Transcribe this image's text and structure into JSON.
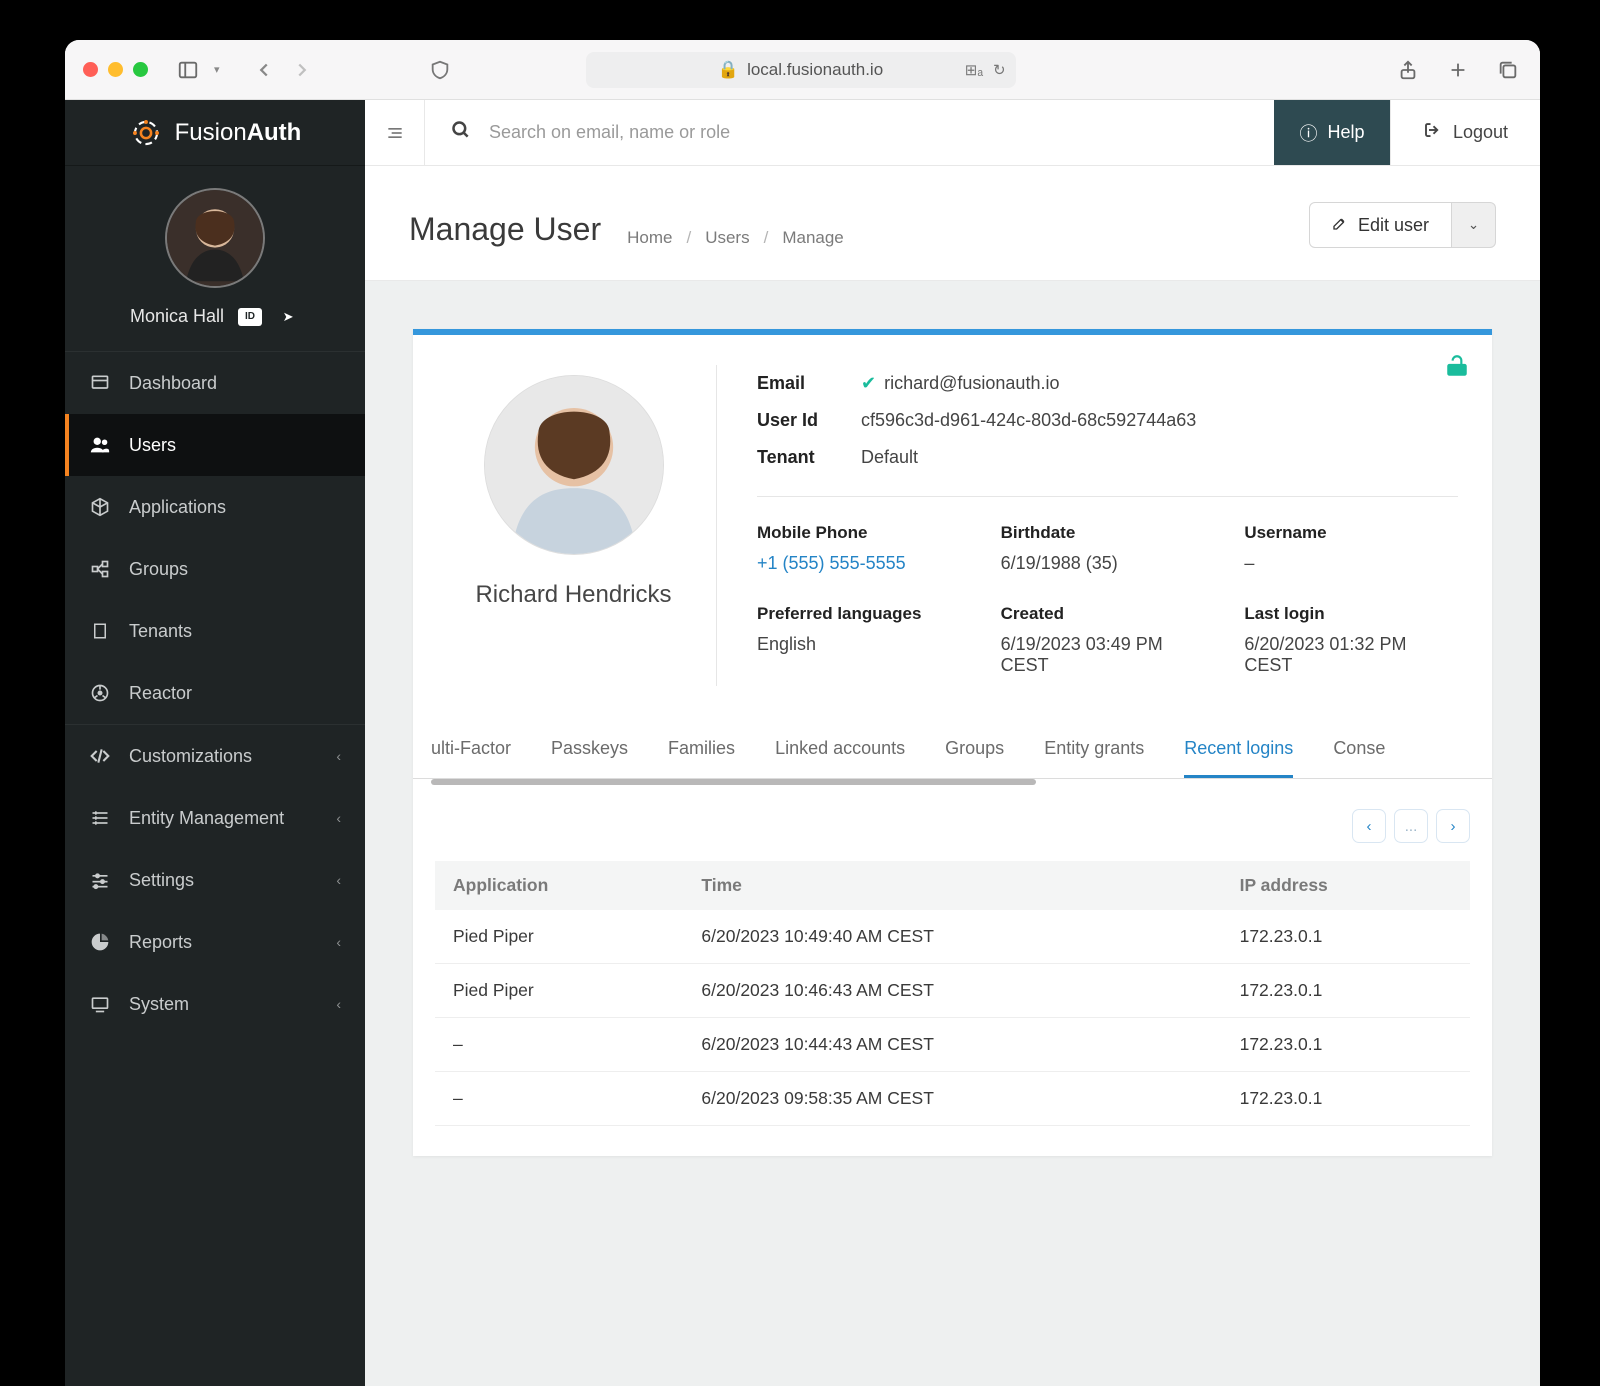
{
  "browser": {
    "address": "local.fusionauth.io"
  },
  "brand": {
    "first": "Fusion",
    "second": "Auth"
  },
  "currentUser": {
    "name": "Monica Hall"
  },
  "sidebar": {
    "items": [
      {
        "icon": "dashboard",
        "label": "Dashboard",
        "expandable": false
      },
      {
        "icon": "users",
        "label": "Users",
        "expandable": false,
        "active": true
      },
      {
        "icon": "applications",
        "label": "Applications",
        "expandable": false
      },
      {
        "icon": "groups",
        "label": "Groups",
        "expandable": false
      },
      {
        "icon": "tenants",
        "label": "Tenants",
        "expandable": false
      },
      {
        "icon": "reactor",
        "label": "Reactor",
        "expandable": false
      }
    ],
    "items2": [
      {
        "icon": "code",
        "label": "Customizations",
        "expandable": true
      },
      {
        "icon": "entity",
        "label": "Entity Management",
        "expandable": true
      },
      {
        "icon": "settings",
        "label": "Settings",
        "expandable": true
      },
      {
        "icon": "reports",
        "label": "Reports",
        "expandable": true
      },
      {
        "icon": "system",
        "label": "System",
        "expandable": true
      }
    ]
  },
  "topbar": {
    "search_placeholder": "Search on email, name or role",
    "help": "Help",
    "logout": "Logout"
  },
  "page": {
    "title": "Manage User",
    "breadcrumb": [
      "Home",
      "Users",
      "Manage"
    ],
    "edit_button": "Edit user"
  },
  "user": {
    "name": "Richard Hendricks",
    "labels": {
      "email": "Email",
      "user_id": "User Id",
      "tenant": "Tenant"
    },
    "email": "richard@fusionauth.io",
    "user_id": "cf596c3d-d961-424c-803d-68c592744a63",
    "tenant": "Default",
    "fields": {
      "mobile_phone": {
        "label": "Mobile Phone",
        "value": "+1 (555) 555-5555"
      },
      "birthdate": {
        "label": "Birthdate",
        "value": "6/19/1988 (35)"
      },
      "username": {
        "label": "Username",
        "value": "–"
      },
      "preferred_languages": {
        "label": "Preferred languages",
        "value": "English"
      },
      "created": {
        "label": "Created",
        "value": "6/19/2023 03:49 PM CEST"
      },
      "last_login": {
        "label": "Last login",
        "value": "6/20/2023 01:32 PM CEST"
      }
    }
  },
  "tabs": {
    "partial_left": "ulti-Factor",
    "items": [
      "Passkeys",
      "Families",
      "Linked accounts",
      "Groups",
      "Entity grants",
      "Recent logins"
    ],
    "partial_right": "Conse",
    "active_index": 5
  },
  "logins": {
    "headers": {
      "application": "Application",
      "time": "Time",
      "ip": "IP address"
    },
    "rows": [
      {
        "application": "Pied Piper",
        "time": "6/20/2023 10:49:40 AM CEST",
        "ip": "172.23.0.1"
      },
      {
        "application": "Pied Piper",
        "time": "6/20/2023 10:46:43 AM CEST",
        "ip": "172.23.0.1"
      },
      {
        "application": "–",
        "time": "6/20/2023 10:44:43 AM CEST",
        "ip": "172.23.0.1"
      },
      {
        "application": "–",
        "time": "6/20/2023 09:58:35 AM CEST",
        "ip": "172.23.0.1"
      }
    ]
  },
  "pager": {
    "dots": "..."
  }
}
